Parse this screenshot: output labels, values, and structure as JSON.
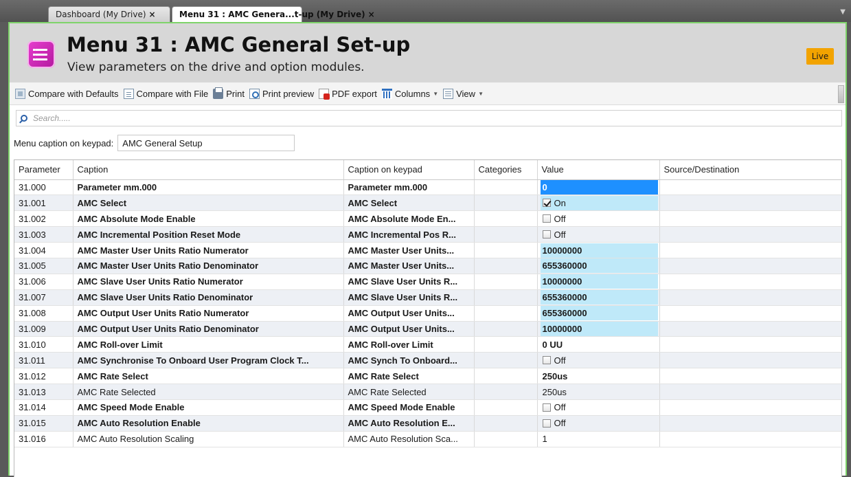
{
  "tabs": [
    {
      "label": "Dashboard (My Drive)",
      "close": "×",
      "active": false
    },
    {
      "label": "Menu 31 : AMC Genera...t-up (My Drive)",
      "close": "×",
      "active": true
    }
  ],
  "header": {
    "title": "Menu 31 : AMC General Set-up",
    "subtitle": "View parameters on the drive and option modules.",
    "badge": "Live",
    "badge_color": "#f2a300",
    "icon": "menu-list-icon"
  },
  "toolbar": {
    "compare_defaults": "Compare with Defaults",
    "compare_file": "Compare with File",
    "print": "Print",
    "print_preview": "Print preview",
    "pdf_export": "PDF export",
    "columns": "Columns",
    "view": "View"
  },
  "search": {
    "placeholder": "Search....."
  },
  "keypad": {
    "label": "Menu caption on keypad:",
    "value": "AMC General Setup"
  },
  "grid": {
    "columns": [
      "Parameter",
      "Caption",
      "Caption on keypad",
      "Categories",
      "Value",
      "Source/Destination"
    ],
    "rows": [
      {
        "param": "31.000",
        "caption": "Parameter mm.000",
        "keypad": "Parameter mm.000",
        "categories": "",
        "value": "0",
        "type": "text",
        "bold": true,
        "style": "sel",
        "source": ""
      },
      {
        "param": "31.001",
        "caption": "AMC Select",
        "keypad": "AMC Select",
        "categories": "",
        "value": "On",
        "type": "check",
        "checked": true,
        "bold": true,
        "style": "hl",
        "source": ""
      },
      {
        "param": "31.002",
        "caption": "AMC Absolute Mode Enable",
        "keypad": "AMC Absolute Mode En...",
        "categories": "",
        "value": "Off",
        "type": "check",
        "checked": false,
        "bold": true,
        "style": "",
        "source": ""
      },
      {
        "param": "31.003",
        "caption": "AMC Incremental Position Reset Mode",
        "keypad": "AMC Incremental Pos R...",
        "categories": "",
        "value": "Off",
        "type": "check",
        "checked": false,
        "bold": true,
        "style": "",
        "source": ""
      },
      {
        "param": "31.004",
        "caption": "AMC Master User Units Ratio Numerator",
        "keypad": "AMC Master User Units...",
        "categories": "",
        "value": "10000000",
        "type": "text",
        "bold": true,
        "style": "hl",
        "source": ""
      },
      {
        "param": "31.005",
        "caption": "AMC Master User Units Ratio Denominator",
        "keypad": "AMC Master User Units...",
        "categories": "",
        "value": "655360000",
        "type": "text",
        "bold": true,
        "style": "hl",
        "source": ""
      },
      {
        "param": "31.006",
        "caption": "AMC Slave User Units Ratio Numerator",
        "keypad": "AMC Slave User Units R...",
        "categories": "",
        "value": "10000000",
        "type": "text",
        "bold": true,
        "style": "hl",
        "source": ""
      },
      {
        "param": "31.007",
        "caption": "AMC Slave User Units Ratio Denominator",
        "keypad": "AMC Slave User Units R...",
        "categories": "",
        "value": "655360000",
        "type": "text",
        "bold": true,
        "style": "hl",
        "source": ""
      },
      {
        "param": "31.008",
        "caption": "AMC Output User Units Ratio Numerator",
        "keypad": "AMC Output User Units...",
        "categories": "",
        "value": "655360000",
        "type": "text",
        "bold": true,
        "style": "hl",
        "source": ""
      },
      {
        "param": "31.009",
        "caption": "AMC Output User Units Ratio Denominator",
        "keypad": "AMC Output User Units...",
        "categories": "",
        "value": "10000000",
        "type": "text",
        "bold": true,
        "style": "hl",
        "source": ""
      },
      {
        "param": "31.010",
        "caption": "AMC Roll-over Limit",
        "keypad": "AMC Roll-over Limit",
        "categories": "",
        "value": "0 UU",
        "type": "text",
        "bold": true,
        "style": "",
        "source": ""
      },
      {
        "param": "31.011",
        "caption": "AMC Synchronise To Onboard User Program Clock T...",
        "keypad": "AMC Synch To Onboard...",
        "categories": "",
        "value": "Off",
        "type": "check",
        "checked": false,
        "bold": true,
        "style": "",
        "source": ""
      },
      {
        "param": "31.012",
        "caption": "AMC Rate Select",
        "keypad": "AMC Rate Select",
        "categories": "",
        "value": "250us",
        "type": "text",
        "bold": true,
        "style": "",
        "source": ""
      },
      {
        "param": "31.013",
        "caption": "AMC Rate Selected",
        "keypad": "AMC Rate Selected",
        "categories": "",
        "value": "250us",
        "type": "text",
        "bold": false,
        "style": "",
        "source": ""
      },
      {
        "param": "31.014",
        "caption": "AMC Speed Mode Enable",
        "keypad": "AMC Speed Mode Enable",
        "categories": "",
        "value": "Off",
        "type": "check",
        "checked": false,
        "bold": true,
        "style": "",
        "source": ""
      },
      {
        "param": "31.015",
        "caption": "AMC Auto Resolution Enable",
        "keypad": "AMC Auto Resolution E...",
        "categories": "",
        "value": "Off",
        "type": "check",
        "checked": false,
        "bold": true,
        "style": "",
        "source": ""
      },
      {
        "param": "31.016",
        "caption": "AMC Auto Resolution Scaling",
        "keypad": "AMC Auto Resolution Sca...",
        "categories": "",
        "value": "1",
        "type": "text",
        "bold": false,
        "style": "",
        "source": ""
      }
    ]
  }
}
